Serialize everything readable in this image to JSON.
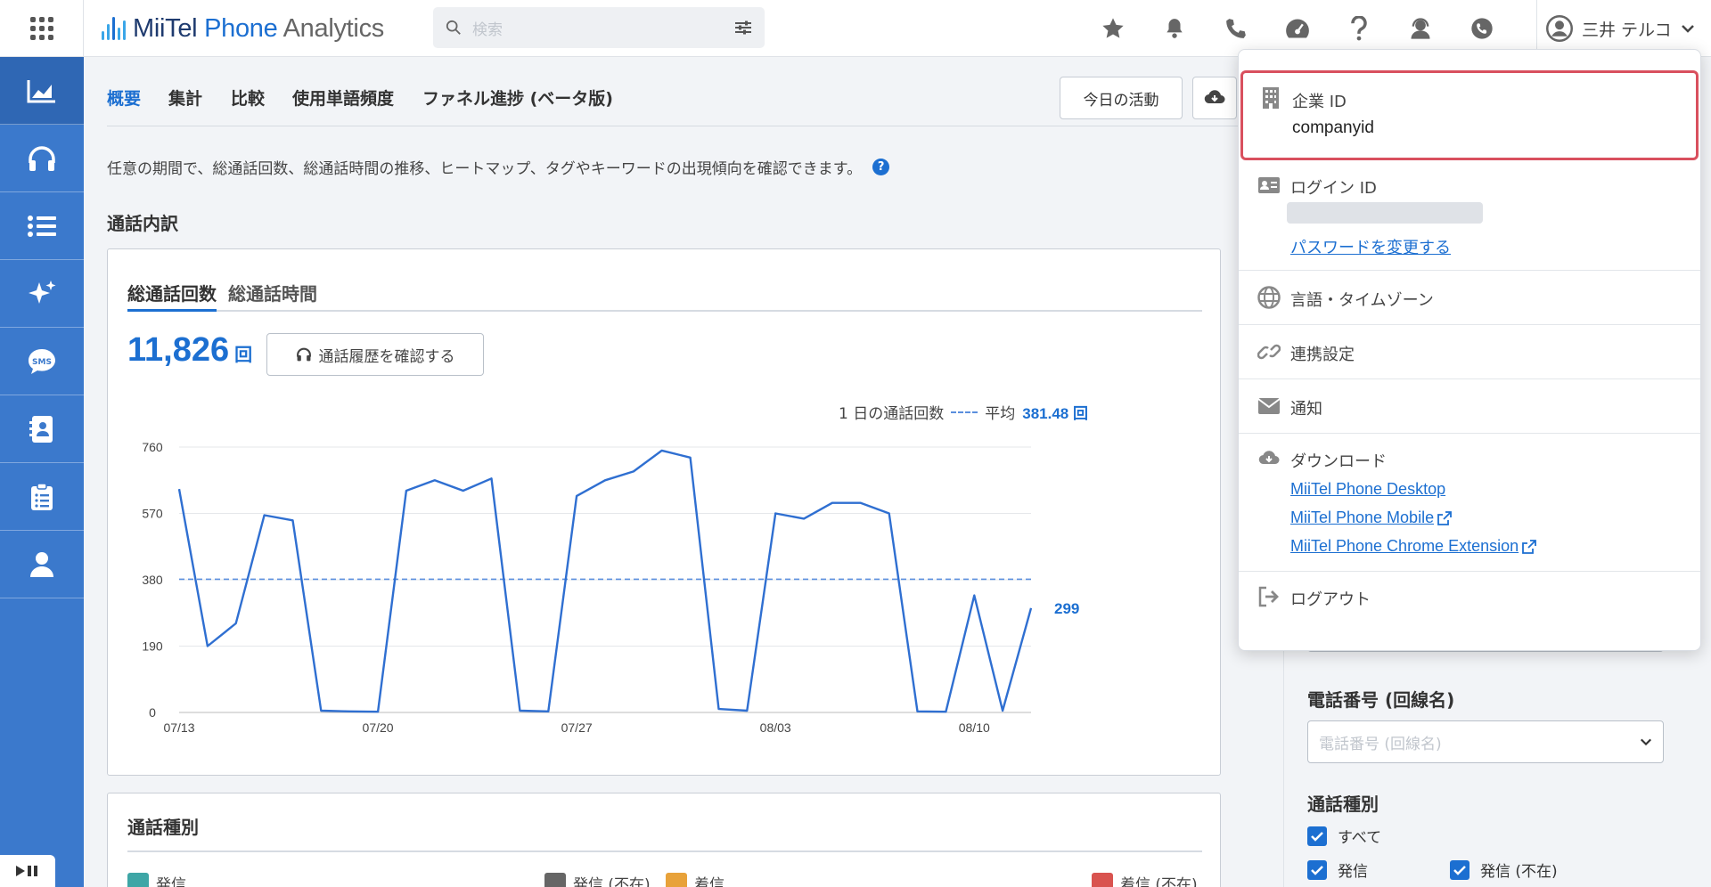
{
  "app": {
    "logo_part1": "MiiTel",
    "logo_part2": "Phone",
    "logo_part3": "Analytics"
  },
  "search": {
    "placeholder": "検索"
  },
  "top_icons": [
    "star-icon",
    "bell-icon",
    "phone-icon",
    "speedometer-icon",
    "help-icon",
    "headset-user-icon",
    "phone-signal-icon"
  ],
  "user": {
    "name": "三井 テルコ"
  },
  "sidebar": {
    "items": [
      "analytics-icon",
      "headphones-icon",
      "list-icon",
      "sparkle-icon",
      "sms-icon",
      "contacts-icon",
      "clipboard-icon",
      "user-icon"
    ]
  },
  "tabs": [
    "概要",
    "集計",
    "比較",
    "使用単語頻度",
    "ファネル進捗 (ベータ版)"
  ],
  "actions": {
    "today": "今日の活動"
  },
  "description": "任意の期間で、総通話回数、総通話時間の推移、ヒートマップ、タグやキーワードの出現傾向を確認できます。",
  "section_title": "通話内訳",
  "card": {
    "tabs": [
      "総通話回数",
      "総通話時間"
    ],
    "total": "11,826",
    "total_unit": "回",
    "history_button": "通話履歴を確認する",
    "legend_label": "1 日の通話回数",
    "legend_avg_label": "平均",
    "legend_avg_value": "381.48",
    "legend_avg_unit": "回",
    "last_value_label": "299"
  },
  "chart_data": {
    "type": "line",
    "x_tick_labels": [
      "07/13",
      "07/20",
      "07/27",
      "08/03",
      "08/10"
    ],
    "y_tick_labels": [
      "760",
      "570",
      "380",
      "190",
      "0"
    ],
    "ylim": [
      0,
      760
    ],
    "average": 381.48,
    "grid": true,
    "series": [
      {
        "values": [
          640,
          190,
          255,
          565,
          550,
          5,
          3,
          2,
          635,
          665,
          635,
          670,
          5,
          3,
          620,
          665,
          690,
          750,
          730,
          10,
          5,
          570,
          555,
          600,
          600,
          570,
          3,
          2,
          335,
          5,
          299
        ]
      }
    ]
  },
  "card2": {
    "title": "通話種別",
    "types": [
      {
        "label": "発信",
        "color": "#3ea6a6"
      },
      {
        "label": "発信 (不在)",
        "color": "#666666"
      },
      {
        "label": "着信",
        "color": "#e8a23a"
      },
      {
        "label": "着信 (不在)",
        "color": "#d9534f"
      }
    ]
  },
  "filters": {
    "phone_title": "電話番号 (回線名)",
    "phone_placeholder": "電話番号 (回線名)",
    "call_type_title": "通話種別",
    "check_all": "すべて",
    "check_outgoing": "発信",
    "check_outgoing_missed": "発信 (不在)"
  },
  "menu": {
    "company_id_label": "企業 ID",
    "company_id_value": "companyid",
    "login_id_label": "ログイン ID",
    "change_password": "パスワードを変更する",
    "language": "言語・タイムゾーン",
    "integrations": "連携設定",
    "notifications": "通知",
    "download": "ダウンロード",
    "download_links": [
      "MiiTel Phone Desktop",
      "MiiTel Phone Mobile",
      "MiiTel Phone Chrome Extension"
    ],
    "logout": "ログアウト"
  },
  "colors": {
    "accent": "#1c6fd1",
    "sidebar": "#3b79cc",
    "highlight_border": "#d9505e"
  }
}
